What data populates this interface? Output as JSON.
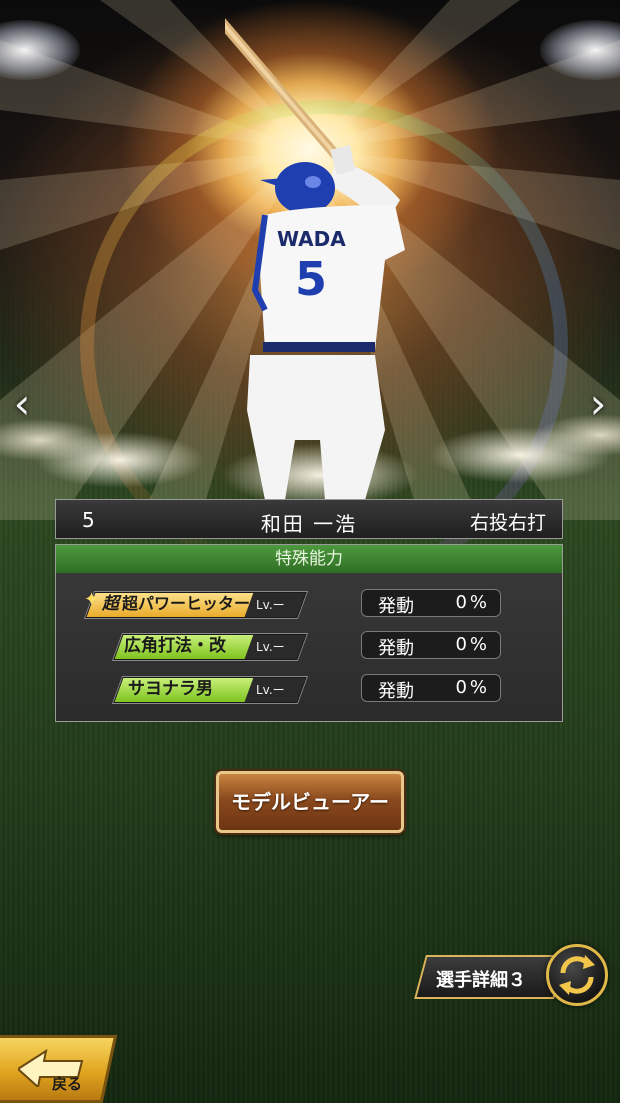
{
  "navigation": {
    "prev_arrow": "‹",
    "next_arrow": "›"
  },
  "player": {
    "jersey_name": "WADA",
    "jersey_number_on_shirt": "5",
    "number": "5",
    "name": "和田 一浩",
    "throw_bat": "右投右打"
  },
  "abilities": {
    "header": "特殊能力",
    "items": [
      {
        "prefix": "超",
        "name": "超パワーヒッター",
        "level": "Lv.ー",
        "status": "発動",
        "percent": "0%",
        "color": "#f4c24a"
      },
      {
        "name": "広角打法・改",
        "level": "Lv.ー",
        "status": "発動",
        "percent": "0%",
        "color": "#9fd83a"
      },
      {
        "name": "サヨナラ男",
        "level": "Lv.ー",
        "status": "発動",
        "percent": "0%",
        "color": "#9fd83a"
      }
    ]
  },
  "buttons": {
    "model_viewer": "モデルビューアー",
    "player_detail": "選手詳細３",
    "back": "戻る"
  },
  "icons": {
    "swap": "swap-arrows-icon",
    "back": "back-arrow-icon",
    "sparkle": "sparkle-icon"
  }
}
